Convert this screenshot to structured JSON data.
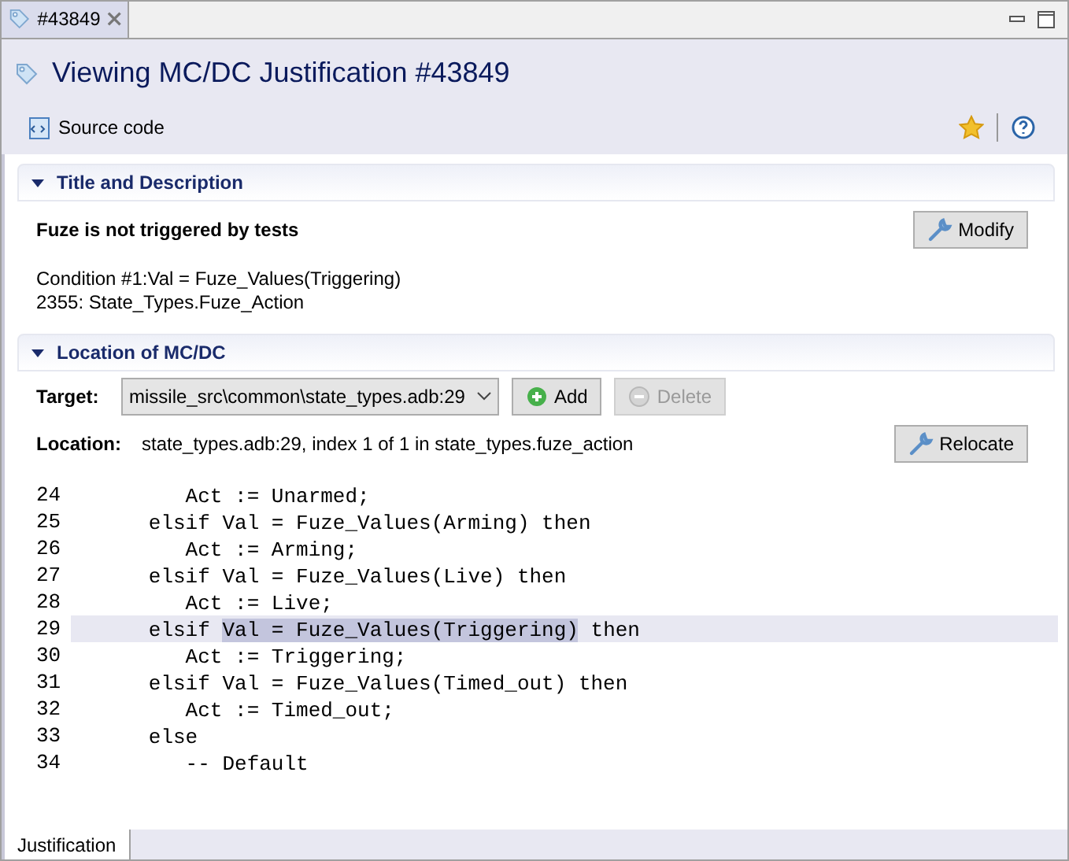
{
  "editor_tab": {
    "label": "#43849",
    "selected": true
  },
  "header": {
    "title": "Viewing MC/DC Justification #43849",
    "toolbar": {
      "source_code": "Source code"
    }
  },
  "sections": [
    {
      "title": "Title and Description",
      "expanded": true
    },
    {
      "title": "Location of MC/DC",
      "expanded": true
    }
  ],
  "description": {
    "heading": "Fuze is not triggered by tests",
    "modify": "Modify",
    "lines": [
      "Condition #1:Val = Fuze_Values(Triggering)",
      "2355: State_Types.Fuze_Action"
    ]
  },
  "location": {
    "target_label": "Target:",
    "target_value": "missile_src\\common\\state_types.adb:29",
    "add": {
      "label": "Add",
      "disabled": false
    },
    "delete": {
      "label": "Delete",
      "disabled": true
    },
    "location_label": "Location:",
    "location_value": "state_types.adb:29, index 1 of 1 in state_types.fuze_action",
    "relocate": "Relocate"
  },
  "code": [
    {
      "number": "24",
      "current": false,
      "segments": [
        {
          "text": "      Act := Unarmed;",
          "selected": false
        }
      ]
    },
    {
      "number": "25",
      "current": false,
      "segments": [
        {
          "text": "   elsif Val = Fuze_Values(Arming) then",
          "selected": false
        }
      ]
    },
    {
      "number": "26",
      "current": false,
      "segments": [
        {
          "text": "      Act := Arming;",
          "selected": false
        }
      ]
    },
    {
      "number": "27",
      "current": false,
      "segments": [
        {
          "text": "   elsif Val = Fuze_Values(Live) then",
          "selected": false
        }
      ]
    },
    {
      "number": "28",
      "current": false,
      "segments": [
        {
          "text": "      Act := Live;",
          "selected": false
        }
      ]
    },
    {
      "number": "29",
      "current": true,
      "segments": [
        {
          "text": "   elsif ",
          "selected": false
        },
        {
          "text": "Val = Fuze_Values(Triggering)",
          "selected": true
        },
        {
          "text": " then",
          "selected": false
        }
      ]
    },
    {
      "number": "30",
      "current": false,
      "segments": [
        {
          "text": "      Act := Triggering;",
          "selected": false
        }
      ]
    },
    {
      "number": "31",
      "current": false,
      "segments": [
        {
          "text": "   elsif Val = Fuze_Values(Timed_out) then",
          "selected": false
        }
      ]
    },
    {
      "number": "32",
      "current": false,
      "segments": [
        {
          "text": "      Act := Timed_out;",
          "selected": false
        }
      ]
    },
    {
      "number": "33",
      "current": false,
      "segments": [
        {
          "text": "   else",
          "selected": false
        }
      ]
    },
    {
      "number": "34",
      "current": false,
      "segments": [
        {
          "text": "      -- Default",
          "selected": false
        }
      ]
    }
  ],
  "bottom_tabs": [
    {
      "label": "Justification",
      "selected": true
    }
  ]
}
